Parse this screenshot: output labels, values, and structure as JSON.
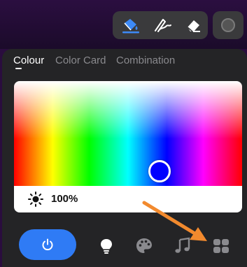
{
  "toolbar": {
    "tools": [
      "paint-bucket-icon",
      "pen-icon",
      "eraser-icon"
    ],
    "active_tool": "paint-bucket-icon",
    "record_icon": "record-icon"
  },
  "tabs": [
    {
      "label": "Colour",
      "active": true
    },
    {
      "label": "Color Card",
      "active": false
    },
    {
      "label": "Combination",
      "active": false
    }
  ],
  "picker": {
    "selected_color": "#0000ff"
  },
  "brightness": {
    "value": "100%"
  },
  "bottom_bar": {
    "items": [
      "power-icon",
      "bulb-icon",
      "palette-icon",
      "music-icon",
      "grid-icon"
    ],
    "accent": "#2f7bf5"
  },
  "annotation": {
    "arrow_color": "#f28a2e"
  }
}
